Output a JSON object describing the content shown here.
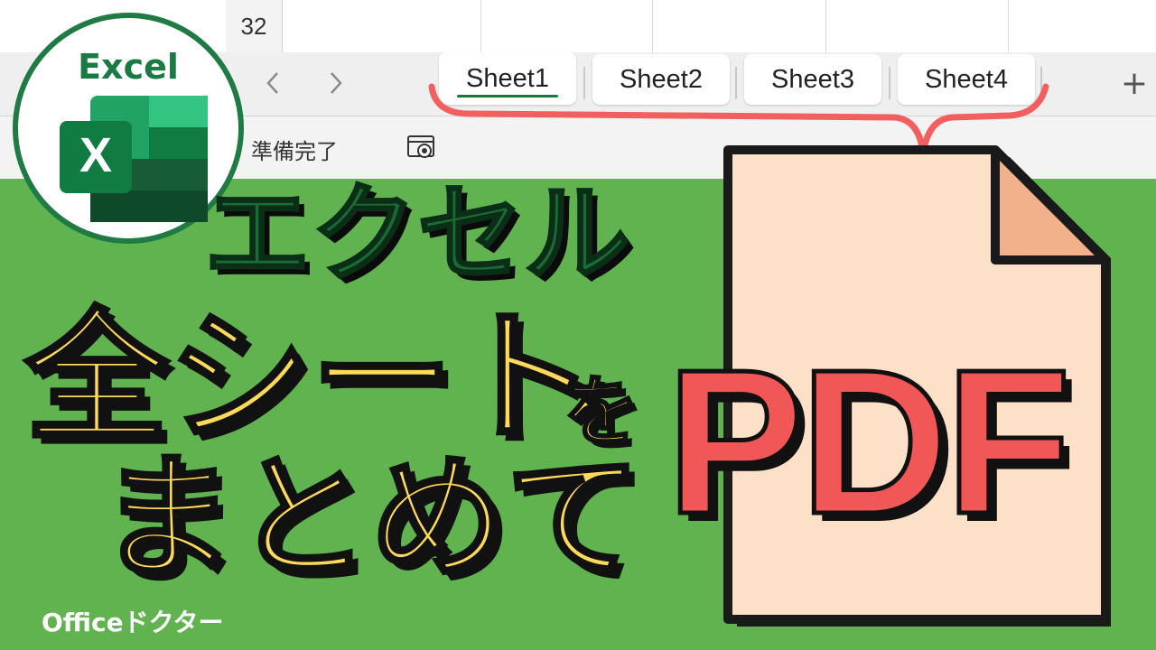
{
  "spreadsheet": {
    "row_number": "32",
    "nav_prev_icon": "chevron-left-icon",
    "nav_next_icon": "chevron-right-icon",
    "tabs": [
      {
        "label": "Sheet1",
        "active": true
      },
      {
        "label": "Sheet2",
        "active": false
      },
      {
        "label": "Sheet3",
        "active": false
      },
      {
        "label": "Sheet4",
        "active": false
      }
    ],
    "add_sheet_label": "+",
    "status_text": "準備完了",
    "status_icon": "accessibility-icon"
  },
  "logo": {
    "word": "Excel",
    "letter": "X"
  },
  "headline": {
    "line1": "エクセル",
    "line2": "全シート",
    "particle": "を",
    "line3": "まとめて",
    "target": "PDF"
  },
  "footer": {
    "brand": "Officeドクター"
  },
  "colors": {
    "background": "#60b34f",
    "excel_green": "#1a6b36",
    "headline_yellow": "#ffd95a",
    "pdf_red": "#f25757",
    "document_fill": "#fde0c8",
    "document_fold": "#f3b18b",
    "brace": "#f25f5f"
  }
}
